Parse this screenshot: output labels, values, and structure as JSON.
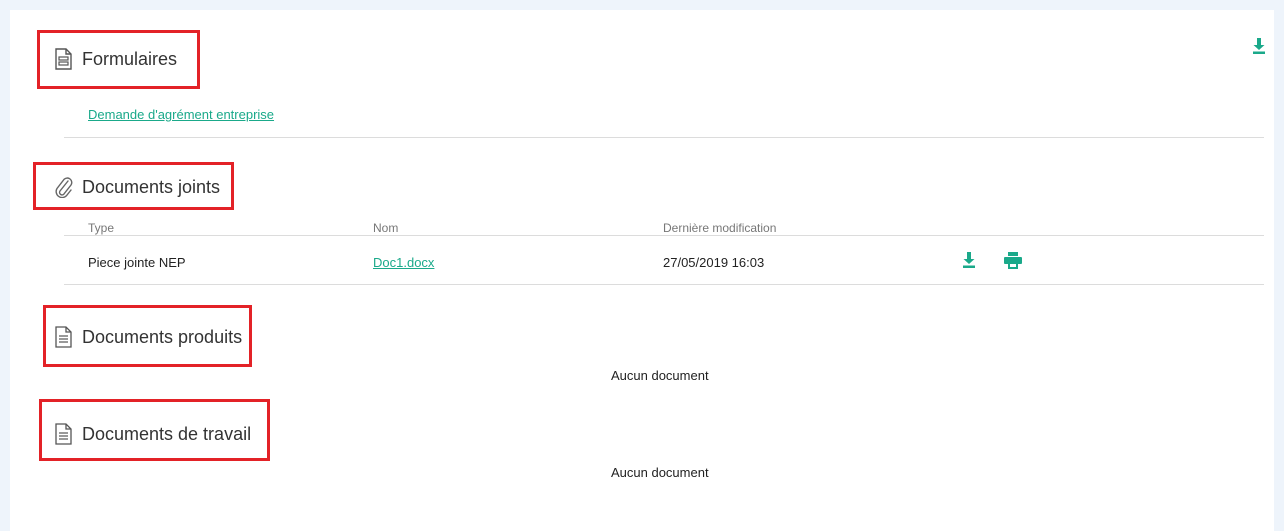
{
  "colors": {
    "accent": "#1aa98a",
    "highlight_box": "#e32227",
    "background": "#eef4fb"
  },
  "top_actions": {
    "download_icon": "download-icon"
  },
  "formulaires": {
    "title": "Formulaires",
    "icon": "form-document-icon",
    "links": [
      "Demande d'agrément entreprise"
    ]
  },
  "documents_joints": {
    "title": "Documents joints",
    "icon": "paperclip-icon",
    "columns": [
      "Type",
      "Nom",
      "Dernière modification"
    ],
    "rows": [
      {
        "type": "Piece jointe NEP",
        "name": "Doc1.docx",
        "modified": "27/05/2019 16:03",
        "actions": [
          "download-icon",
          "print-icon"
        ]
      }
    ]
  },
  "documents_produits": {
    "title": "Documents produits",
    "icon": "document-icon",
    "empty_message": "Aucun document"
  },
  "documents_travail": {
    "title": "Documents de travail",
    "icon": "document-icon",
    "empty_message": "Aucun document"
  }
}
